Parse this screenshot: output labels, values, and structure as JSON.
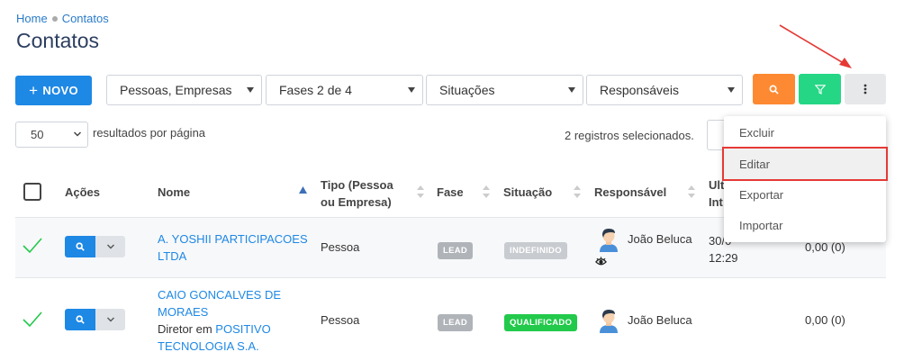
{
  "breadcrumb": {
    "home": "Home",
    "current": "Contatos"
  },
  "page_title": "Contatos",
  "toolbar": {
    "new_button": "NOVO",
    "filters": [
      "Pessoas, Empresas",
      "Fases 2 de 4",
      "Situações",
      "Responsáveis"
    ]
  },
  "pagination": {
    "per_page": "50",
    "per_page_label": "resultados por página"
  },
  "selection_status": "2 registros selecionados.",
  "table": {
    "headers": {
      "actions": "Ações",
      "name": "Nome",
      "type_line1": "Tipo (Pessoa",
      "type_line2": "ou Empresa)",
      "phase": "Fase",
      "status": "Situação",
      "owner": "Responsável",
      "last_line1": "Ult",
      "last_line2": "Int"
    },
    "rows": [
      {
        "name_line1": "A. YOSHII PARTICIPACOES",
        "name_line2": "LTDA",
        "type": "Pessoa",
        "phase": "LEAD",
        "status": "INDEFINIDO",
        "owner": "João Beluca",
        "last_date": "30/0",
        "last_time": "12:29",
        "value": "0,00 (0)"
      },
      {
        "name_line1": "CAIO GONCALVES DE",
        "name_line2": "MORAES",
        "subtitle_prefix": "Diretor em ",
        "company_line1": "POSITIVO",
        "company_line2": "TECNOLOGIA S.A.",
        "type": "Pessoa",
        "phase": "LEAD",
        "status": "QUALIFICADO",
        "owner": "João Beluca",
        "value": "0,00 (0)"
      }
    ]
  },
  "menu": {
    "items": [
      "Excluir",
      "Editar",
      "Exportar",
      "Importar"
    ],
    "active": "Editar"
  },
  "colors": {
    "primary": "#1e88e5",
    "search": "#fd8a32",
    "filter": "#25d685",
    "qualified": "#22c94b",
    "annotation": "#e53935"
  }
}
